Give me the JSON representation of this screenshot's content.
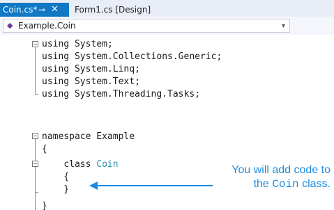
{
  "tabs": [
    {
      "label": "Coin.cs*",
      "active": true,
      "pin_icon": "pin-icon",
      "close_icon": "close-icon",
      "pin_glyph": "⊸",
      "close_glyph": "✕"
    },
    {
      "label": "Form1.cs [Design]",
      "active": false
    }
  ],
  "navigation": {
    "selected": "Example.Coin",
    "icon": "class-icon",
    "icon_glyph": "◆",
    "dropdown_icon": "chevron-down-icon",
    "dropdown_glyph": "▾"
  },
  "code": {
    "lines": [
      "using System;",
      "using System.Collections.Generic;",
      "using System.Linq;",
      "using System.Text;",
      "using System.Threading.Tasks;",
      "",
      "namespace Example",
      "{",
      "    class Coin",
      "    {",
      "    }",
      "}"
    ],
    "keywords": {
      "using": "using",
      "namespace": "namespace",
      "class": "class"
    },
    "namespaces": {
      "system": "System",
      "collections": "System.Collections.Generic",
      "linq": "System.Linq",
      "text": "System.Text",
      "tasks": "System.Threading.Tasks",
      "example": "Example"
    },
    "class_name": "Coin"
  },
  "annotation": {
    "line1": "You will add code to",
    "line2_prefix": "the ",
    "line2_code": "Coin",
    "line2_suffix": " class."
  },
  "colors": {
    "active_tab": "#1178c4",
    "callout": "#1a8ce2",
    "class_name": "#2b91af"
  }
}
